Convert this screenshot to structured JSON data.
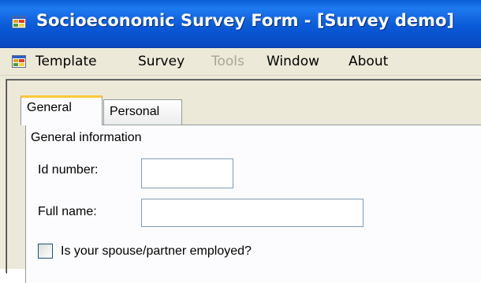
{
  "window": {
    "title": "Socioeconomic Survey Form - [Survey demo]",
    "app_icon": "form-window-icon"
  },
  "menu": {
    "icon": "form-window-icon",
    "items": [
      {
        "label": "Template",
        "enabled": true
      },
      {
        "label": "Survey",
        "enabled": true
      },
      {
        "label": "Tools",
        "enabled": false
      },
      {
        "label": "Window",
        "enabled": true
      },
      {
        "label": "About",
        "enabled": true
      }
    ]
  },
  "tabs": [
    {
      "label": "General",
      "selected": true
    },
    {
      "label": "Personal",
      "selected": false
    }
  ],
  "general": {
    "group_label": "General information",
    "id_label": "Id number:",
    "id_value": "",
    "name_label": "Full name:",
    "name_value": "",
    "spouse_label": "Is your spouse/partner employed?",
    "spouse_checked": false
  },
  "colors": {
    "titlebar": "#0a5ad8",
    "menubar": "#ece9d8",
    "tab_highlight": "#ffc83c",
    "input_border": "#7f9db9"
  }
}
